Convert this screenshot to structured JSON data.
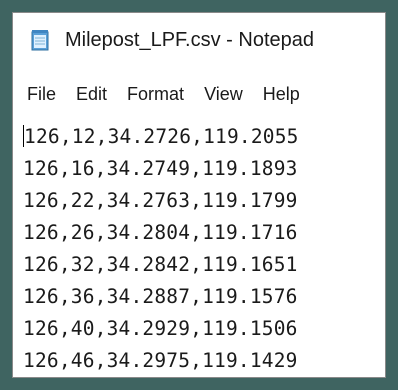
{
  "window": {
    "title": "Milepost_LPF.csv - Notepad"
  },
  "menu": {
    "items": [
      {
        "label": "File"
      },
      {
        "label": "Edit"
      },
      {
        "label": "Format"
      },
      {
        "label": "View"
      },
      {
        "label": "Help"
      }
    ]
  },
  "editor": {
    "lines": [
      "126,12,34.2726,119.2055",
      "126,16,34.2749,119.1893",
      "126,22,34.2763,119.1799",
      "126,26,34.2804,119.1716",
      "126,32,34.2842,119.1651",
      "126,36,34.2887,119.1576",
      "126,40,34.2929,119.1506",
      "126,46,34.2975,119.1429"
    ]
  },
  "icons": {
    "app": "notepad-icon"
  }
}
